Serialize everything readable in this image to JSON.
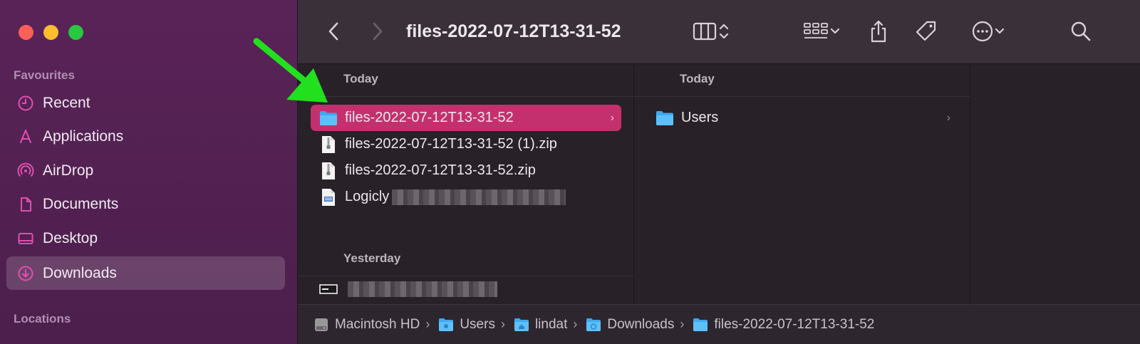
{
  "sidebar": {
    "favourites_heading": "Favourites",
    "locations_heading": "Locations",
    "items": [
      {
        "label": "Recent",
        "icon": "clock-icon"
      },
      {
        "label": "Applications",
        "icon": "applications-icon"
      },
      {
        "label": "AirDrop",
        "icon": "airdrop-icon"
      },
      {
        "label": "Documents",
        "icon": "document-icon"
      },
      {
        "label": "Desktop",
        "icon": "desktop-icon"
      },
      {
        "label": "Downloads",
        "icon": "download-icon",
        "active": true
      }
    ]
  },
  "toolbar": {
    "title": "files-2022-07-12T13-31-52"
  },
  "column1": {
    "today_heading": "Today",
    "yesterday_heading": "Yesterday",
    "rows": [
      {
        "name": "files-2022-07-12T13-31-52",
        "type": "folder",
        "selected": true
      },
      {
        "name": "files-2022-07-12T13-31-52 (1).zip",
        "type": "zip"
      },
      {
        "name": "files-2022-07-12T13-31-52.zip",
        "type": "zip"
      },
      {
        "name": "Logicly",
        "type": "document",
        "redacted": true
      }
    ],
    "yesterday_rows": [
      {
        "name": "",
        "type": "screen",
        "redacted": true
      }
    ]
  },
  "column2": {
    "today_heading": "Today",
    "rows": [
      {
        "name": "Users",
        "type": "folder"
      }
    ]
  },
  "pathbar": {
    "crumbs": [
      {
        "label": "Macintosh HD",
        "icon": "hard-drive-icon"
      },
      {
        "label": "Users",
        "icon": "folder-icon"
      },
      {
        "label": "lindat",
        "icon": "home-folder-icon"
      },
      {
        "label": "Downloads",
        "icon": "downloads-folder-icon"
      },
      {
        "label": "files-2022-07-12T13-31-52",
        "icon": "folder-icon"
      }
    ]
  },
  "colors": {
    "accent_pink": "#c4306e",
    "sidebar_icon": "#e24fb0",
    "folder_blue": "#3fa9f0",
    "annotation_arrow": "#22e01e"
  }
}
